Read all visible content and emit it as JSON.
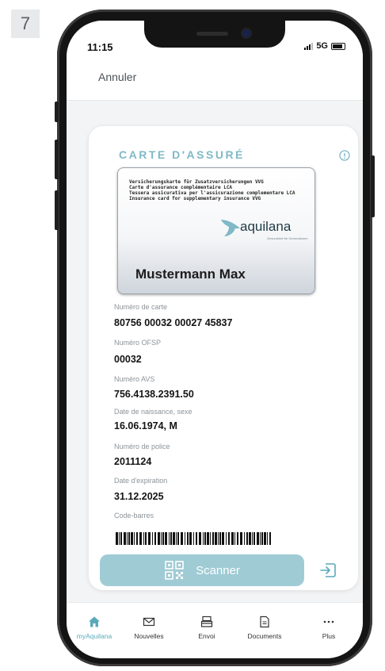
{
  "step_number": "7",
  "status_bar": {
    "time": "11:15",
    "network": "5G"
  },
  "header": {
    "cancel_label": "Annuler"
  },
  "card": {
    "title": "CARTE D'ASSURÉ",
    "insurance_card": {
      "lines": [
        "Versicherungskarte für Zusatzversicherungen VVG",
        "Carte d'assurance complémentaire LCA",
        "Tessera assicurativa per l'assicurazione complementare LCA",
        "Insurance card for supplementary insurance VVG"
      ],
      "brand": "aquilana",
      "tagline": "Gesundheit für Generationen",
      "holder_name": "Mustermann Max"
    },
    "fields": [
      {
        "label": "Numéro de carte",
        "value": "80756 00032 00027 45837"
      },
      {
        "label": "Numéro OFSP",
        "value": "00032"
      },
      {
        "label": "Numéro AVS",
        "value": "756.4138.2391.50"
      },
      {
        "label": "Date de naissance, sexe",
        "value": "16.06.1974, M"
      },
      {
        "label": "Numéro de police",
        "value": "2011124"
      },
      {
        "label": "Date d'expiration",
        "value": "31.12.2025"
      }
    ],
    "barcode_label": "Code-barres",
    "scan_button_label": "Scanner"
  },
  "tabbar": {
    "tabs": [
      {
        "label": "myAquilana",
        "icon": "home-icon",
        "active": true
      },
      {
        "label": "Nouvelles",
        "icon": "mail-icon",
        "active": false
      },
      {
        "label": "Envoi",
        "icon": "send-icon",
        "active": false
      },
      {
        "label": "Documents",
        "icon": "document-icon",
        "active": false
      },
      {
        "label": "Plus",
        "icon": "more-icon",
        "active": false
      }
    ]
  },
  "colors": {
    "accent": "#7fb9c6",
    "button": "#9fcbd5",
    "active_tab": "#5aa9ba"
  }
}
